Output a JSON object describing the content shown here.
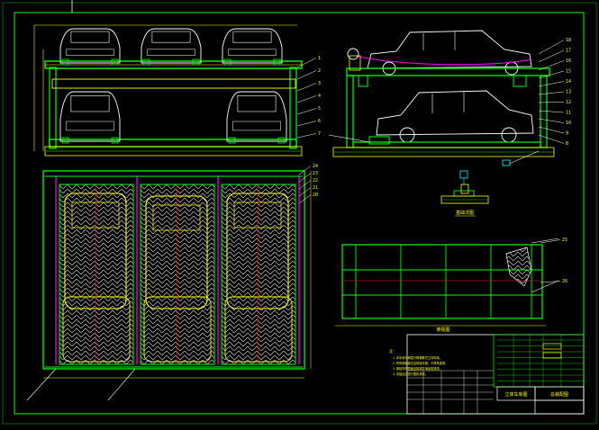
{
  "drawing": {
    "title_block": {
      "drawing_title_cn": "立体车库图",
      "drawing_no": "总装配图",
      "rows": [
        "标记",
        "处数",
        "分区",
        "设计",
        "审核",
        "工艺",
        "批准",
        "更改文件号",
        "签名",
        "年月日",
        "标准化",
        "阶段标记",
        "重量",
        "比例",
        "共 张",
        "第 张"
      ]
    },
    "section_labels": {
      "detail": "基础详图",
      "plan_view": "俯视图"
    },
    "notes_title": "注：",
    "notes": [
      "1.本车库为两层升降横移式立体车库。",
      "2.所有焊接部位应焊接牢固，不得有虚焊。",
      "3.钢结构件表面应除锈并喷涂防锈漆。",
      "4.安装后应进行整机调试。"
    ],
    "callouts_right": [
      "18",
      "17",
      "16",
      "15",
      "14",
      "13",
      "12",
      "11",
      "10",
      "9",
      "8"
    ],
    "callouts_front": [
      "1",
      "2",
      "3",
      "4",
      "5",
      "6",
      "7"
    ],
    "callouts_plan": [
      "24",
      "23",
      "22",
      "21",
      "20"
    ],
    "callouts_side_plan": [
      "25",
      "26"
    ],
    "colors": {
      "frame_green": "#00ff00",
      "yellow": "#ffff00",
      "magenta": "#ff00ff",
      "red": "#ff2020",
      "white": "#ffffff",
      "cyan": "#00ffff",
      "gray": "#9a9a9a"
    }
  }
}
